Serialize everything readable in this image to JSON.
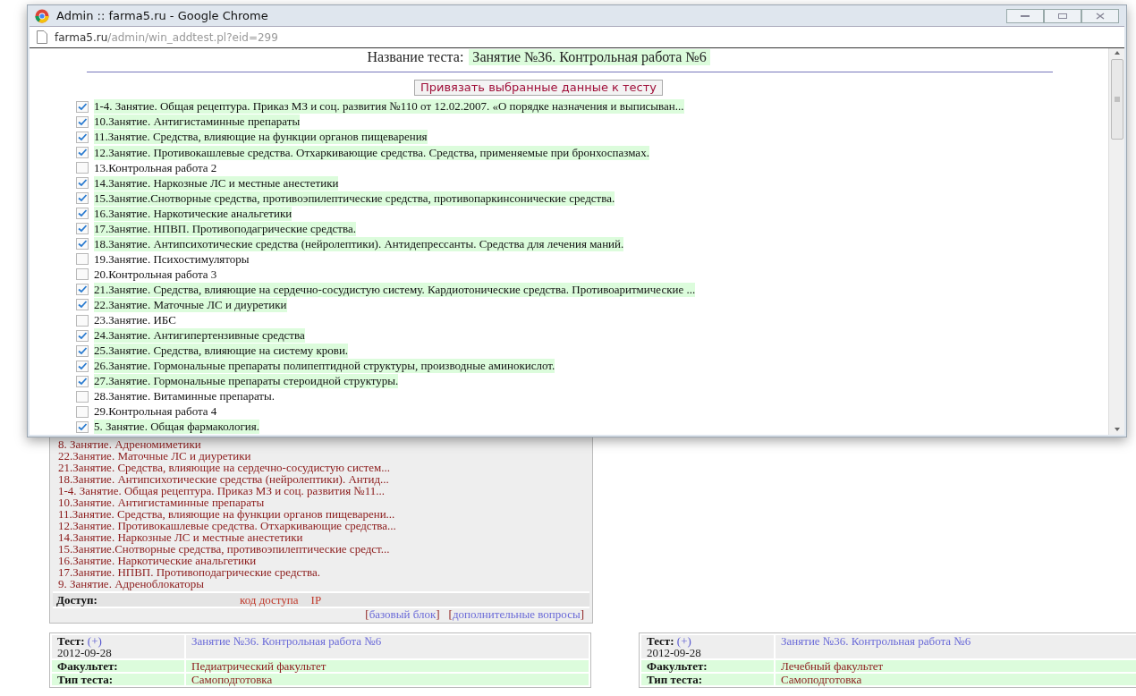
{
  "browser_window": {
    "title": "Admin :: farma5.ru - Google Chrome",
    "url_host": "farma5.ru",
    "url_path": "/admin/win_addtest.pl?eid=299"
  },
  "test_name": {
    "label": "Название теста:",
    "value": "Занятие №36. Контрольная работа №6"
  },
  "bind_button": "Привязать выбранные данные к тесту",
  "items": [
    {
      "label": "1-4. Занятие. Общая рецептура. Приказ МЗ и соц. развития №110 от 12.02.2007. «О порядке назначения и выписыван...",
      "checked": true
    },
    {
      "label": "10.Занятие. Антигистаминные препараты",
      "checked": true
    },
    {
      "label": "11.Занятие. Средства, влияющие на функции органов пищеварения",
      "checked": true
    },
    {
      "label": "12.Занятие. Противокашлевые средства. Отхаркивающие средства. Средства, применяемые при бронхоспазмах.",
      "checked": true
    },
    {
      "label": "13.Контрольная работа 2",
      "checked": false
    },
    {
      "label": "14.Занятие. Наркозные ЛС и местные анестетики",
      "checked": true
    },
    {
      "label": "15.Занятие.Снотворные средства, противоэпилептические средства, противопаркинсонические средства.",
      "checked": true
    },
    {
      "label": "16.Занятие. Наркотические анальгетики",
      "checked": true
    },
    {
      "label": "17.Занятие. НПВП. Противоподагрические средства.",
      "checked": true
    },
    {
      "label": "18.Занятие. Антипсихотические средства (нейролептики). Антидепрессанты. Средства для лечения маний.",
      "checked": true
    },
    {
      "label": "19.Занятие. Психостимуляторы",
      "checked": false
    },
    {
      "label": "20.Контрольная работа 3",
      "checked": false
    },
    {
      "label": "21.Занятие. Средства, влияющие на сердечно-сосудистую систему. Кардиотонические средства. Противоаритмические ...",
      "checked": true
    },
    {
      "label": "22.Занятие. Маточные ЛС и диуретики",
      "checked": true
    },
    {
      "label": "23.Занятие. ИБС",
      "checked": false
    },
    {
      "label": "24.Занятие. Антигипертензивные средства",
      "checked": true
    },
    {
      "label": "25.Занятие. Средства, влияющие на систему крови.",
      "checked": true
    },
    {
      "label": "26.Занятие. Гормональные препараты полипептидной структуры, производные аминокислот.",
      "checked": true
    },
    {
      "label": "27.Занятие. Гормональные препараты стероидной структуры.",
      "checked": true
    },
    {
      "label": "28.Занятие. Витаминные препараты.",
      "checked": false
    },
    {
      "label": "29.Контрольная работа 4",
      "checked": false
    },
    {
      "label": "5. Занятие. Общая фармакология.",
      "checked": true
    }
  ],
  "background": {
    "linked_items": [
      "8. Занятие. Адреномиметики",
      "22.Занятие. Маточные ЛС и диуретики",
      "21.Занятие. Средства, влияющие на сердечно-сосудистую систем...",
      "18.Занятие. Антипсихотические средства (нейролептики). Антид...",
      "1-4. Занятие. Общая рецептура. Приказ МЗ и соц. развития №11...",
      "10.Занятие. Антигистаминные препараты",
      "11.Занятие. Средства, влияющие на функции органов пищеварени...",
      "12.Занятие. Противокашлевые средства. Отхаркивающие средства...",
      "14.Занятие. Наркозные ЛС и местные анестетики",
      "15.Занятие.Снотворные средства, противоэпилептические средст...",
      "16.Занятие. Наркотические анальгетики",
      "17.Занятие. НПВП. Противоподагрические средства.",
      "9. Занятие. Адреноблокаторы"
    ],
    "access": {
      "label": "Доступ:",
      "values": [
        "код доступа",
        "IP"
      ]
    },
    "links": [
      {
        "open": "[",
        "label": "базовый блок",
        "close": "]"
      },
      {
        "open": "[",
        "label": "дополнительные вопросы",
        "close": "]"
      }
    ],
    "cards": [
      {
        "test_label": "Тест:",
        "plus": "(+)",
        "date": "2012-09-28",
        "test_name": "Занятие №36. Контрольная работа №6",
        "faculty_label": "Факультет:",
        "faculty": "Педиатрический факультет",
        "type_label": "Тип теста:",
        "type": "Самоподготовка"
      },
      {
        "test_label": "Тест:",
        "plus": "(+)",
        "date": "2012-09-28",
        "test_name": "Занятие №36. Контрольная работа №6",
        "faculty_label": "Факультет:",
        "faculty": "Лечебный факультет",
        "type_label": "Тип теста:",
        "type": "Самоподготовка"
      }
    ]
  }
}
